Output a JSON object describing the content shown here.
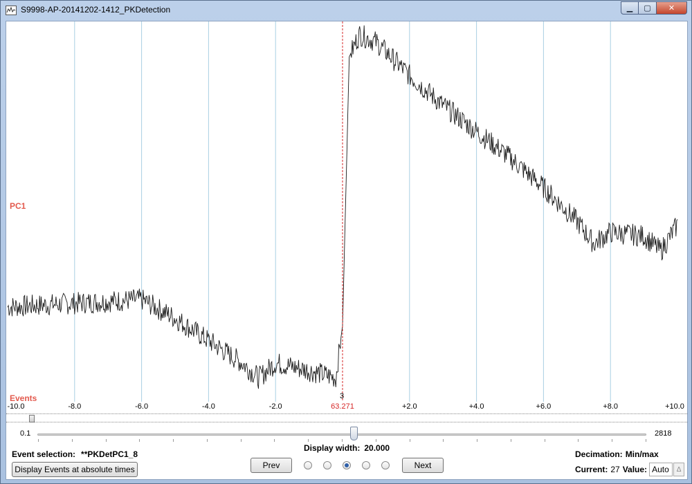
{
  "window": {
    "title": "S9998-AP-20141202-1412_PKDetection",
    "icon": "chart-app-icon",
    "controls": {
      "minimize": "▁",
      "maximize": "▢",
      "close": "✕"
    }
  },
  "plot": {
    "channel_label": "PC1",
    "events_label": "Events",
    "event_number": "3",
    "center_time": "63.271",
    "tick_labels": [
      "-10.0",
      "-8.0",
      "-6.0",
      "-4.0",
      "-2.0",
      "63.271",
      "+2.0",
      "+4.0",
      "+6.0",
      "+8.0",
      "+10.0"
    ],
    "colors": {
      "trace": "#1a1a1a",
      "grid": "#a9cfe3",
      "marker": "#d62525",
      "label": "#e35a4e"
    }
  },
  "chart_data": {
    "type": "line",
    "title": "",
    "xlabel": "",
    "ylabel": "PC1",
    "xlim": [
      -10,
      10
    ],
    "ylim": [
      0,
      1
    ],
    "grid": true,
    "x": [
      -10,
      -8,
      -6,
      -5,
      -4,
      -3,
      -2.5,
      -2,
      -1,
      -0.2,
      0,
      0.2,
      0.5,
      1,
      2,
      3,
      4,
      5,
      6,
      7,
      7.5,
      8,
      9,
      9.5,
      10
    ],
    "series": [
      {
        "values": [
          0.25,
          0.26,
          0.27,
          0.22,
          0.16,
          0.1,
          0.06,
          0.1,
          0.08,
          0.06,
          0.2,
          0.92,
          0.98,
          0.96,
          0.87,
          0.79,
          0.72,
          0.65,
          0.57,
          0.48,
          0.42,
          0.45,
          0.44,
          0.4,
          0.47
        ]
      }
    ]
  },
  "scrollbar": {
    "position": 0.0
  },
  "width_slider": {
    "min": "0.1",
    "max": "2818",
    "value": 20.0
  },
  "controls": {
    "event_selection_label": "Event selection:",
    "event_selection_value": "**PKDetPC1_8",
    "abs_times_button": "Display Events at absolute times",
    "display_width_label": "Display width:",
    "display_width_value": "20.000",
    "prev_button": "Prev",
    "next_button": "Next",
    "radio_selected_index": 2,
    "decimation_label": "Decimation:",
    "decimation_value": "Min/max",
    "current_label": "Current:",
    "current_value": "27",
    "value_label": "Value:",
    "value_field": "Auto",
    "spin_glyph": "Δ"
  }
}
